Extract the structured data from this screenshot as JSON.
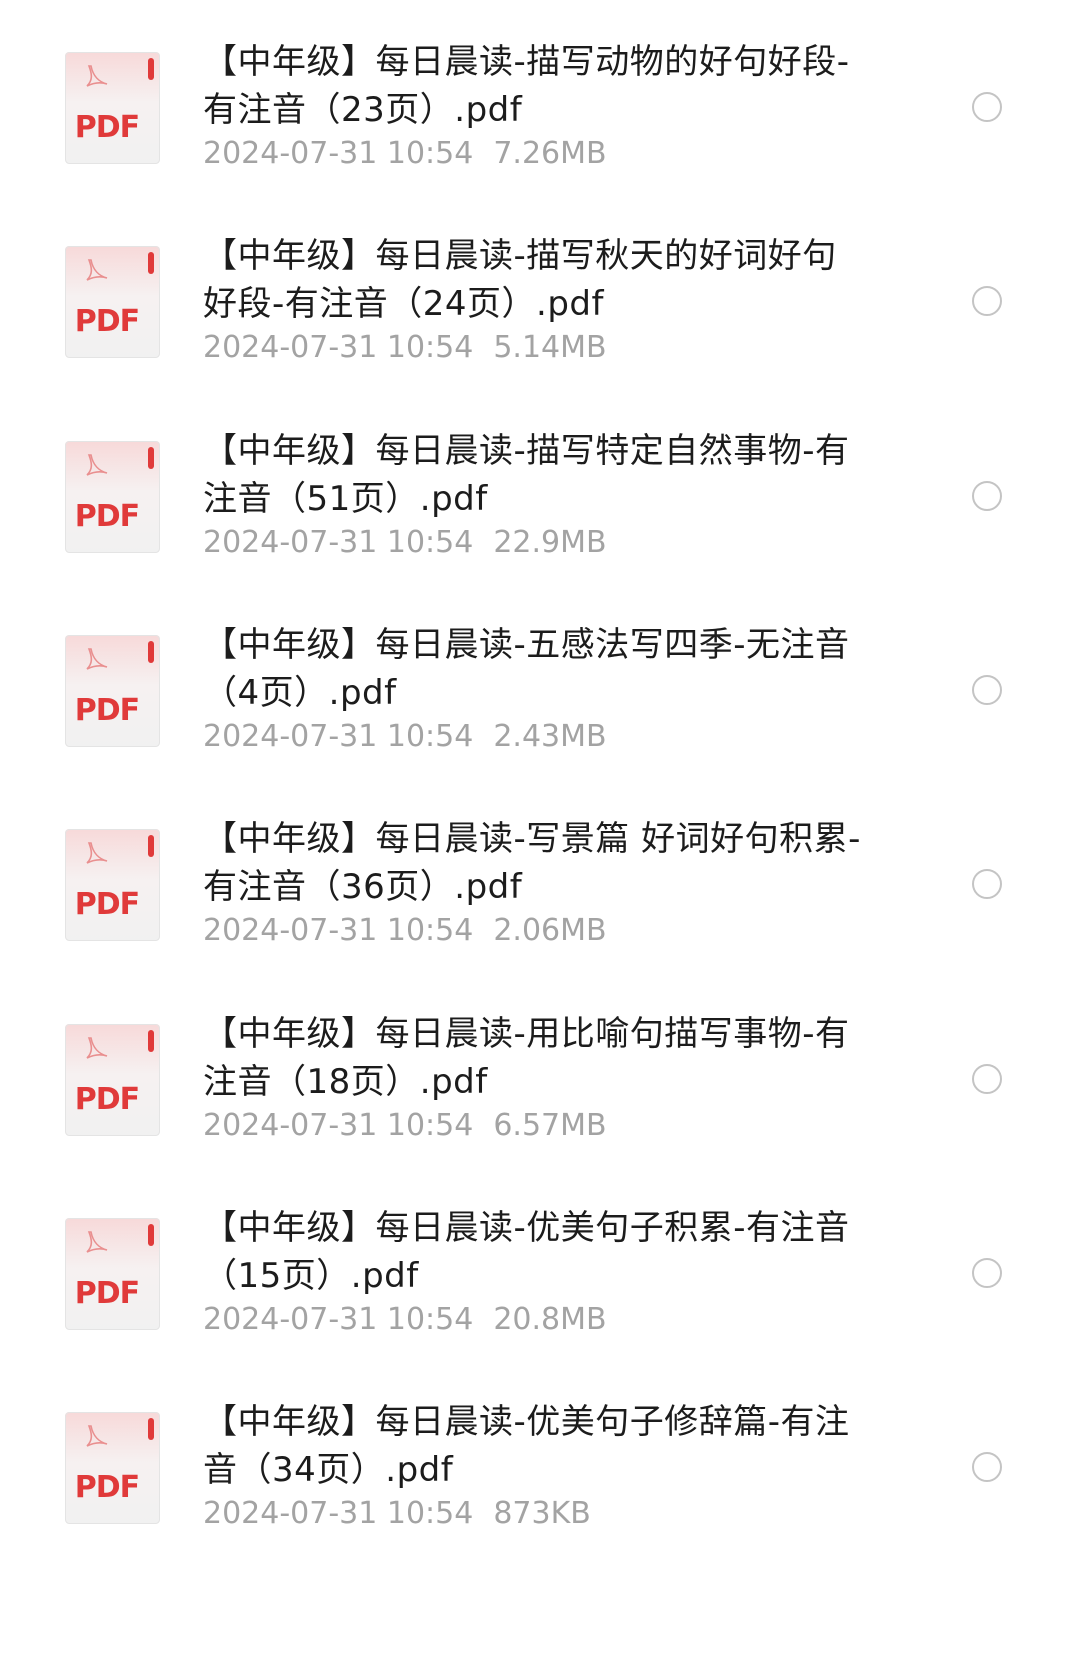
{
  "file_list": {
    "items": [
      {
        "icon": "pdf-file-icon",
        "icon_label": "PDF",
        "name": "【中年级】每日晨读-描写动物的好句好段-有注音（23页）.pdf",
        "date": "2024-07-31 10:54",
        "size": "7.26MB"
      },
      {
        "icon": "pdf-file-icon",
        "icon_label": "PDF",
        "name": "【中年级】每日晨读-描写秋天的好词好句好段-有注音（24页）.pdf",
        "date": "2024-07-31 10:54",
        "size": "5.14MB"
      },
      {
        "icon": "pdf-file-icon",
        "icon_label": "PDF",
        "name": "【中年级】每日晨读-描写特定自然事物-有注音（51页）.pdf",
        "date": "2024-07-31 10:54",
        "size": "22.9MB"
      },
      {
        "icon": "pdf-file-icon",
        "icon_label": "PDF",
        "name": "【中年级】每日晨读-五感法写四季-无注音（4页）.pdf",
        "date": "2024-07-31 10:54",
        "size": "2.43MB"
      },
      {
        "icon": "pdf-file-icon",
        "icon_label": "PDF",
        "name": "【中年级】每日晨读-写景篇 好词好句积累-有注音（36页）.pdf",
        "date": "2024-07-31 10:54",
        "size": "2.06MB"
      },
      {
        "icon": "pdf-file-icon",
        "icon_label": "PDF",
        "name": "【中年级】每日晨读-用比喻句描写事物-有注音（18页）.pdf",
        "date": "2024-07-31 10:54",
        "size": "6.57MB"
      },
      {
        "icon": "pdf-file-icon",
        "icon_label": "PDF",
        "name": "【中年级】每日晨读-优美句子积累-有注音（15页）.pdf",
        "date": "2024-07-31 10:54",
        "size": "20.8MB"
      },
      {
        "icon": "pdf-file-icon",
        "icon_label": "PDF",
        "name": "【中年级】每日晨读-优美句子修辞篇-有注音（34页）.pdf",
        "date": "2024-07-31 10:54",
        "size": "873KB"
      }
    ]
  },
  "colors": {
    "pdf_red": "#e03a3a",
    "pdf_page": "#f2f2f2",
    "name_text": "#1c1c1c",
    "meta_text": "#a3a3a3",
    "radio_border": "#c4c4c4"
  }
}
